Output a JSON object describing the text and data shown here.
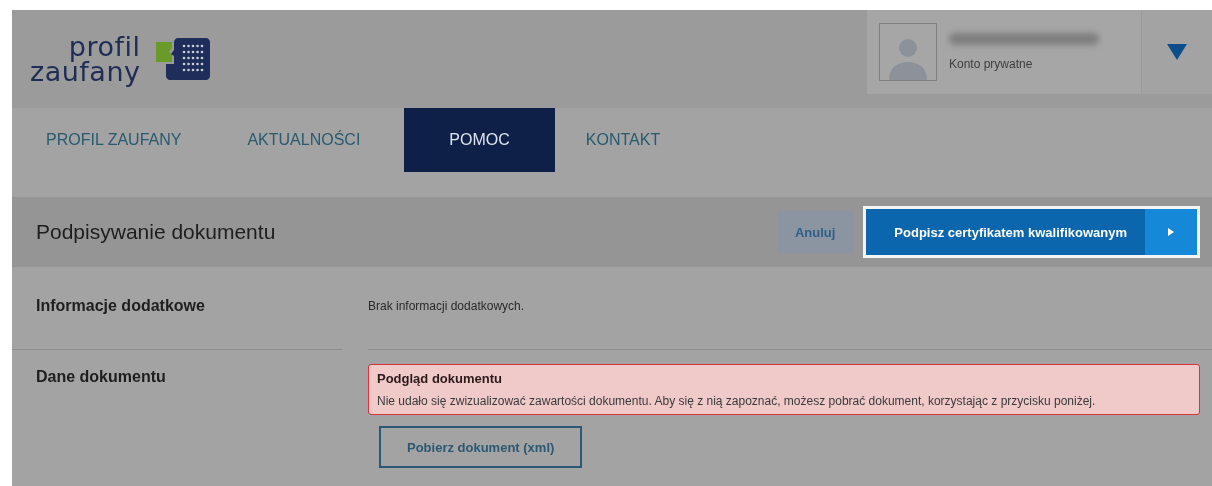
{
  "logo": {
    "line1": "profil",
    "line2": "zaufany"
  },
  "user": {
    "account_type": "Konto prywatne"
  },
  "nav": [
    {
      "label": "PROFIL ZAUFANY",
      "selected": false
    },
    {
      "label": "AKTUALNOŚCI",
      "selected": false
    },
    {
      "label": "POMOC",
      "selected": true
    },
    {
      "label": "KONTAKT",
      "selected": false
    }
  ],
  "section": {
    "title": "Podpisywanie dokumentu",
    "cancel": "Anuluj",
    "sign": "Podpisz certyfikatem kwalifikowanym"
  },
  "rows": [
    {
      "label": "Informacje dodatkowe",
      "kind": "text",
      "text": "Brak informacji dodatkowych."
    },
    {
      "label": "Dane dokumentu",
      "kind": "alert",
      "alert": {
        "title": "Podgląd dokumentu",
        "message": "Nie udało się zwizualizować zawartości dokumentu. Aby się z nią zapoznać, możesz pobrać dokument, korzystając z przycisku poniżej."
      },
      "button": "Pobierz dokument (xml)"
    }
  ]
}
